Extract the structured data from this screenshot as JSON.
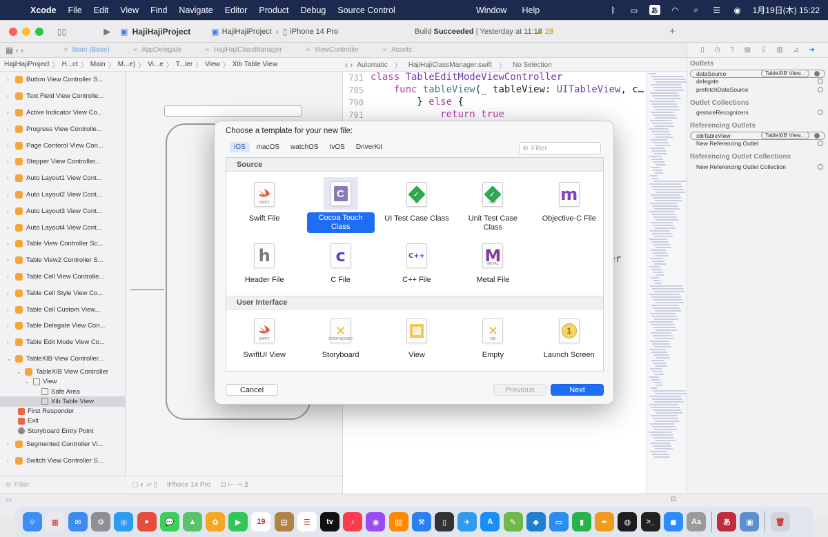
{
  "menubar": {
    "app": "Xcode",
    "items": [
      "File",
      "Edit",
      "View",
      "Find",
      "Navigate",
      "Editor",
      "Product",
      "Debug",
      "Source Control"
    ],
    "center_items": [
      "Window",
      "Help"
    ],
    "ime": "あ",
    "datetime": "1月19日(木)  15:22"
  },
  "toolbar": {
    "project": "HajiHajiProject",
    "scheme": "HajiHajiProject",
    "device": "iPhone 14 Pro",
    "build_label": "Build",
    "build_result": "Succeeded",
    "build_time": "| Yesterday at 11:18",
    "warnings": "28"
  },
  "tabs": [
    {
      "label": "Main (Base)",
      "active": true
    },
    {
      "label": "AppDelegate",
      "active": false
    },
    {
      "label": "HajiHajiClassManager",
      "active": false
    },
    {
      "label": "ViewController",
      "active": false
    },
    {
      "label": "Assets",
      "active": false
    }
  ],
  "breadcrumbs": [
    "HajiHajiProject",
    "H...ct",
    "Main",
    "M...e)",
    "Vi...e",
    "T...ler",
    "View",
    "Xib Table View"
  ],
  "editor_crumbs": [
    "Automatic",
    "HajiHajiClassManager.swift",
    "No Selection"
  ],
  "outline": {
    "items": [
      "Button View Controller S...",
      "Text Field View Controlle...",
      "Active Indicator View Co...",
      "Progress View Controlle...",
      "Page Contorol View Con...",
      "Stepper View Controller...",
      "Auto Layout1 View Cont...",
      "Auto Layout2 View Cont...",
      "Auto Layout3 View Cont...",
      "Auto Layout4 View Cont...",
      "Table View Controller Sc...",
      "Table View2 Controller S...",
      "Table Cell View Controlle...",
      "Table Cell Style View Co...",
      "Table Cell Custom View...",
      "Table Delegate View Con...",
      "Table Edit Mode View Co...",
      "TableXIB View Controller..."
    ],
    "sub_items": {
      "controller": "TableXIB View Controller",
      "view": "View",
      "safe_area": "Safe Area",
      "xib_table_view": "Xib Table View",
      "first_responder": "First Responder",
      "exit": "Exit",
      "entry_point": "Storyboard Entry Point"
    },
    "tail_items": [
      "Segmented Controller Vi...",
      "Switch View Controller S..."
    ],
    "filter_placeholder": "Filter"
  },
  "canvas": {
    "device": "iPhone 14 Pro"
  },
  "code": [
    {
      "ln": "731",
      "parts": [
        [
          "kw",
          "class "
        ],
        [
          "tp",
          "TableEditModeViewController"
        ],
        [
          "",
          ""
        ]
      ]
    },
    {
      "ln": "785",
      "parts": [
        [
          "",
          "    "
        ],
        [
          "kw",
          "func "
        ],
        [
          "fn",
          "tableView"
        ],
        [
          "",
          "(_ tableView: "
        ],
        [
          "tp",
          "UITableView"
        ],
        [
          "",
          ", c…"
        ]
      ]
    },
    {
      "ln": "790",
      "parts": [
        [
          "",
          "        } "
        ],
        [
          "kw",
          "else"
        ],
        [
          "",
          " {"
        ]
      ]
    },
    {
      "ln": "791",
      "parts": [
        [
          "",
          "            "
        ],
        [
          "kw",
          "return "
        ],
        [
          "kw",
          "true"
        ]
      ]
    }
  ],
  "editor_tail": "ler",
  "inspector": {
    "sections": {
      "outlets": "Outlets",
      "outlet_collections": "Outlet Collections",
      "referencing_outlets": "Referencing Outlets",
      "referencing_outlet_collections": "Referencing Outlet Collections"
    },
    "outlets": [
      {
        "name": "dataSource",
        "target": "TableXIB View...",
        "connected": true
      },
      {
        "name": "delegate",
        "connected": false
      },
      {
        "name": "prefetchDataSource",
        "connected": false
      }
    ],
    "collections": [
      {
        "name": "gestureRecognizers"
      }
    ],
    "ref_outlets": [
      {
        "name": "xibTableView",
        "target": "TableXIB View...",
        "connected": true
      },
      {
        "name": "New Referencing Outlet",
        "connected": false
      }
    ],
    "ref_collections": [
      {
        "name": "New Referencing Outlet Collection"
      }
    ]
  },
  "dialog": {
    "title": "Choose a template for your new file:",
    "platforms": [
      "iOS",
      "macOS",
      "watchOS",
      "tvOS",
      "DriverKit"
    ],
    "filter_placeholder": "Filter",
    "sections": [
      {
        "name": "Source",
        "templates": [
          {
            "label": "Swift File",
            "icon": "swift-icon",
            "glyph": "",
            "small": "SWIFT",
            "selected": false
          },
          {
            "label": "Cocoa Touch Class",
            "icon": "cocoa-touch-class-icon",
            "glyph": "C",
            "small": "",
            "selected": true
          },
          {
            "label": "UI Test Case Class",
            "icon": "ui-test-case-icon",
            "glyph": "✓",
            "small": "UI",
            "selected": false
          },
          {
            "label": "Unit Test Case Class",
            "icon": "unit-test-case-icon",
            "glyph": "✓",
            "small": "UNIT",
            "selected": false
          },
          {
            "label": "Objective-C File",
            "icon": "objective-c-icon",
            "glyph": "m",
            "small": "",
            "selected": false
          },
          {
            "label": "Header File",
            "icon": "header-file-icon",
            "glyph": "h",
            "small": "",
            "selected": false
          },
          {
            "label": "C File",
            "icon": "c-file-icon",
            "glyph": "c",
            "small": "",
            "selected": false
          },
          {
            "label": "C++ File",
            "icon": "cpp-file-icon",
            "glyph": "C++",
            "small": "",
            "selected": false
          },
          {
            "label": "Metal File",
            "icon": "metal-file-icon",
            "glyph": "M",
            "small": "METAL",
            "selected": false
          }
        ]
      },
      {
        "name": "User Interface",
        "templates": [
          {
            "label": "SwiftUI View",
            "icon": "swiftui-view-icon",
            "glyph": "",
            "small": "SWIFT",
            "selected": false
          },
          {
            "label": "Storyboard",
            "icon": "storyboard-icon",
            "glyph": "✕",
            "small": "STORYBOARD",
            "selected": false
          },
          {
            "label": "View",
            "icon": "view-icon",
            "glyph": "▢",
            "small": "",
            "selected": false
          },
          {
            "label": "Empty",
            "icon": "empty-xib-icon",
            "glyph": "✕",
            "small": "XIB",
            "selected": false
          },
          {
            "label": "Launch Screen",
            "icon": "launch-screen-icon",
            "glyph": "1",
            "small": "",
            "selected": false
          }
        ]
      }
    ],
    "cancel": "Cancel",
    "previous": "Previous",
    "next": "Next"
  },
  "dock": {
    "apps": [
      {
        "name": "finder",
        "color": "#3a8ef6",
        "glyph": "☺"
      },
      {
        "name": "launchpad",
        "color": "#e8e8ee",
        "glyph": "▦"
      },
      {
        "name": "mail",
        "color": "#3b8bf0",
        "glyph": "✉"
      },
      {
        "name": "system-settings",
        "color": "#8e8e93",
        "glyph": "⚙"
      },
      {
        "name": "safari",
        "color": "#2e9af0",
        "glyph": "◎"
      },
      {
        "name": "chrome",
        "color": "#e64b3b",
        "glyph": "●"
      },
      {
        "name": "messages",
        "color": "#3cd05b",
        "glyph": "💬"
      },
      {
        "name": "maps",
        "color": "#5ac26a",
        "glyph": "▲"
      },
      {
        "name": "photos",
        "color": "#f5a623",
        "glyph": "✿"
      },
      {
        "name": "facetime",
        "color": "#33c759",
        "glyph": "▶"
      },
      {
        "name": "calendar",
        "color": "#ffffff",
        "glyph": "19"
      },
      {
        "name": "notes-brown",
        "color": "#b28146",
        "glyph": "▤"
      },
      {
        "name": "reminders",
        "color": "#ffffff",
        "glyph": "☰"
      },
      {
        "name": "tv",
        "color": "#111111",
        "glyph": "tv"
      },
      {
        "name": "music",
        "color": "#fa3c4c",
        "glyph": "♪"
      },
      {
        "name": "podcasts",
        "color": "#9b4cf0",
        "glyph": "◉"
      },
      {
        "name": "books",
        "color": "#ff8a00",
        "glyph": "▥"
      },
      {
        "name": "xcode",
        "color": "#2b7fef",
        "glyph": "⚒"
      },
      {
        "name": "simulator",
        "color": "#333333",
        "glyph": "▯"
      },
      {
        "name": "testflight",
        "color": "#2f9bef",
        "glyph": "✈"
      },
      {
        "name": "app-store",
        "color": "#1b8ef5",
        "glyph": "A"
      },
      {
        "name": "editor-green",
        "color": "#6fb94a",
        "glyph": "✎"
      },
      {
        "name": "vscode",
        "color": "#1f7fd1",
        "glyph": "◆"
      },
      {
        "name": "keynote",
        "color": "#2d8cf0",
        "glyph": "▭"
      },
      {
        "name": "numbers",
        "color": "#26b34b",
        "glyph": "▮"
      },
      {
        "name": "pages",
        "color": "#f09a1e",
        "glyph": "✒"
      },
      {
        "name": "activity-monitor",
        "color": "#1e1e1e",
        "glyph": "◍"
      },
      {
        "name": "terminal",
        "color": "#222222",
        "glyph": ">_"
      },
      {
        "name": "zoom",
        "color": "#2d8cff",
        "glyph": "◼"
      },
      {
        "name": "dictionary",
        "color": "#9a9a9a",
        "glyph": "Aa"
      },
      {
        "name": "ime-kana",
        "color": "#c42b3a",
        "glyph": "あ"
      },
      {
        "name": "preview",
        "color": "#5d8fcf",
        "glyph": "▣"
      },
      {
        "name": "trash",
        "color": "#d0d4da",
        "glyph": "🗑"
      }
    ]
  },
  "colors": {
    "accent": "#1d6ef4",
    "menubar": "#1c2a4f",
    "keyword": "#ad3da4"
  }
}
